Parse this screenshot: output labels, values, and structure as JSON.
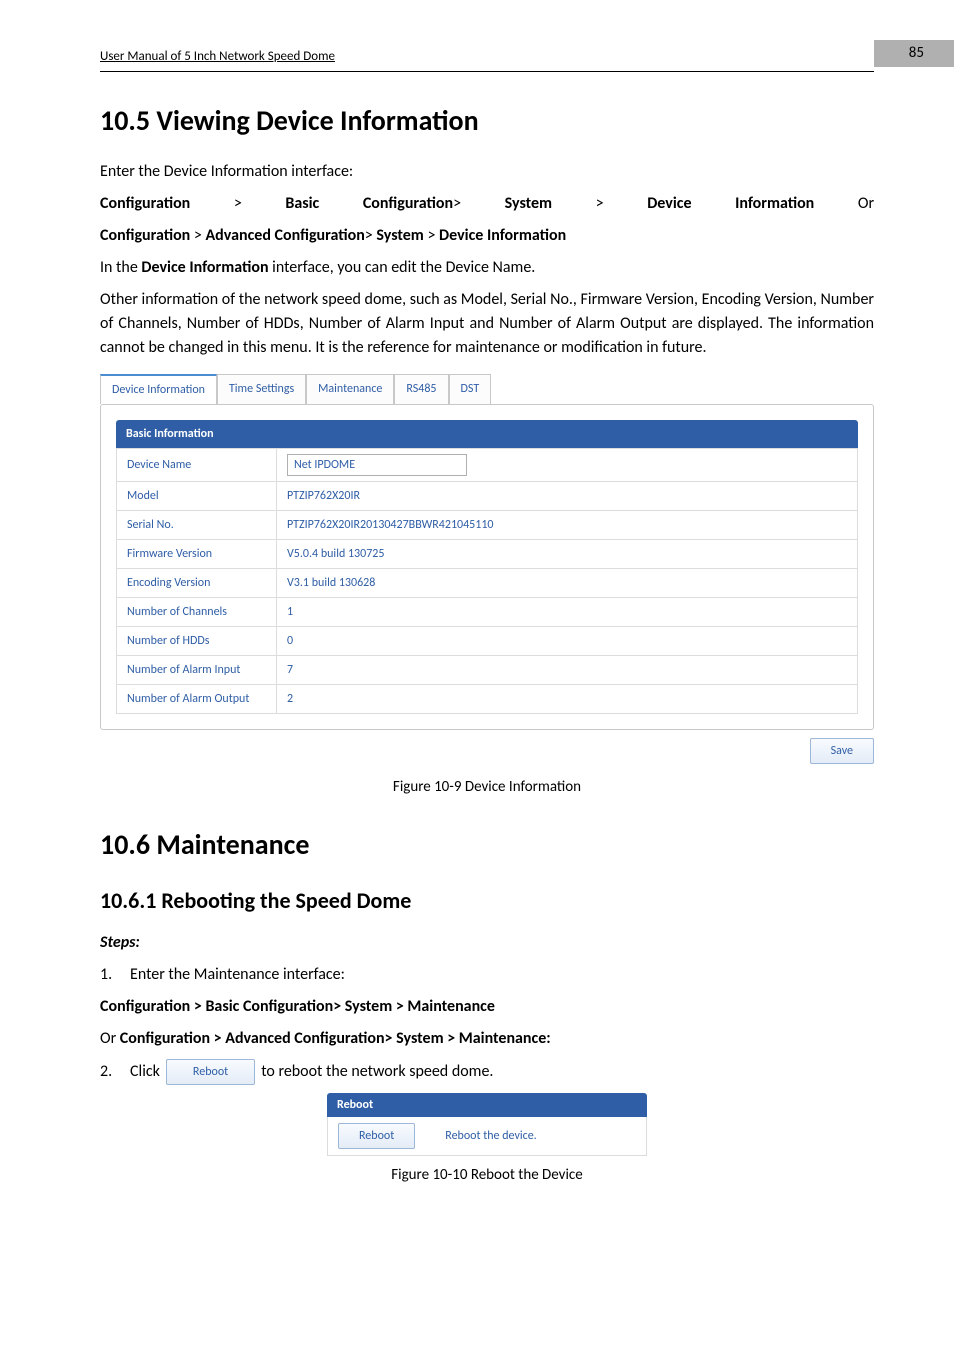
{
  "header": {
    "title": "User Manual of 5 Inch Network Speed Dome",
    "page_number": "85"
  },
  "section_10_5": {
    "heading": "10.5 Viewing Device Information",
    "intro": "Enter the Device Information interface:",
    "path1_a": "Configuration",
    "gt": ">",
    "path1_b": "Basic Configuration",
    "path1_c": "System",
    "path1_d": "Device Information",
    "or": "Or",
    "path2_a": "Configuration",
    "path2_b": "Advanced Configuration",
    "path2_c": "System",
    "path2_d": "Device Information",
    "para_in_the_a": "In the ",
    "para_in_the_b": "Device Information",
    "para_in_the_c": " interface, you can edit the Device Name.",
    "para_other": "Other information of the network speed dome, such as Model, Serial No., Firmware Version, Encoding Version, Number of Channels, Number of HDDs, Number of Alarm Input and Number of Alarm Output are displayed. The information cannot be changed in this menu. It is the reference for maintenance or modification in future."
  },
  "tabs": {
    "t1": "Device Information",
    "t2": "Time Settings",
    "t3": "Maintenance",
    "t4": "RS485",
    "t5": "DST"
  },
  "basic_info": {
    "header": "Basic Information",
    "rows": {
      "device_name_label": "Device Name",
      "device_name_value": "Net IPDOME",
      "model_label": "Model",
      "model_value": "PTZIP762X20IR",
      "serial_label": "Serial No.",
      "serial_value": "PTZIP762X20IR20130427BBWR421045110",
      "fw_label": "Firmware Version",
      "fw_value": "V5.0.4 build 130725",
      "enc_label": "Encoding Version",
      "enc_value": "V3.1 build 130628",
      "chan_label": "Number of Channels",
      "chan_value": "1",
      "hdd_label": "Number of HDDs",
      "hdd_value": "0",
      "ain_label": "Number of Alarm Input",
      "ain_value": "7",
      "aout_label": "Number of Alarm Output",
      "aout_value": "2"
    },
    "save": "Save"
  },
  "figure_10_9": "Figure 10-9 Device Information",
  "section_10_6": {
    "heading": "10.6 Maintenance",
    "sub_heading": "10.6.1 Rebooting the Speed Dome",
    "steps_label": "Steps:",
    "step1_a": "Enter the Maintenance interface:",
    "step1_path1": "Configuration > Basic Configuration> System > Maintenance",
    "step1_or": "Or ",
    "step1_path2": "Configuration > Advanced Configuration> System > Maintenance:",
    "step2_a": "Click",
    "step2_btn": "Reboot",
    "step2_b": "to reboot the network speed dome."
  },
  "reboot_panel": {
    "header": "Reboot",
    "button": "Reboot",
    "desc": "Reboot the device."
  },
  "figure_10_10": "Figure 10-10 Reboot the Device",
  "numbers": {
    "one": "1.",
    "two": "2."
  }
}
